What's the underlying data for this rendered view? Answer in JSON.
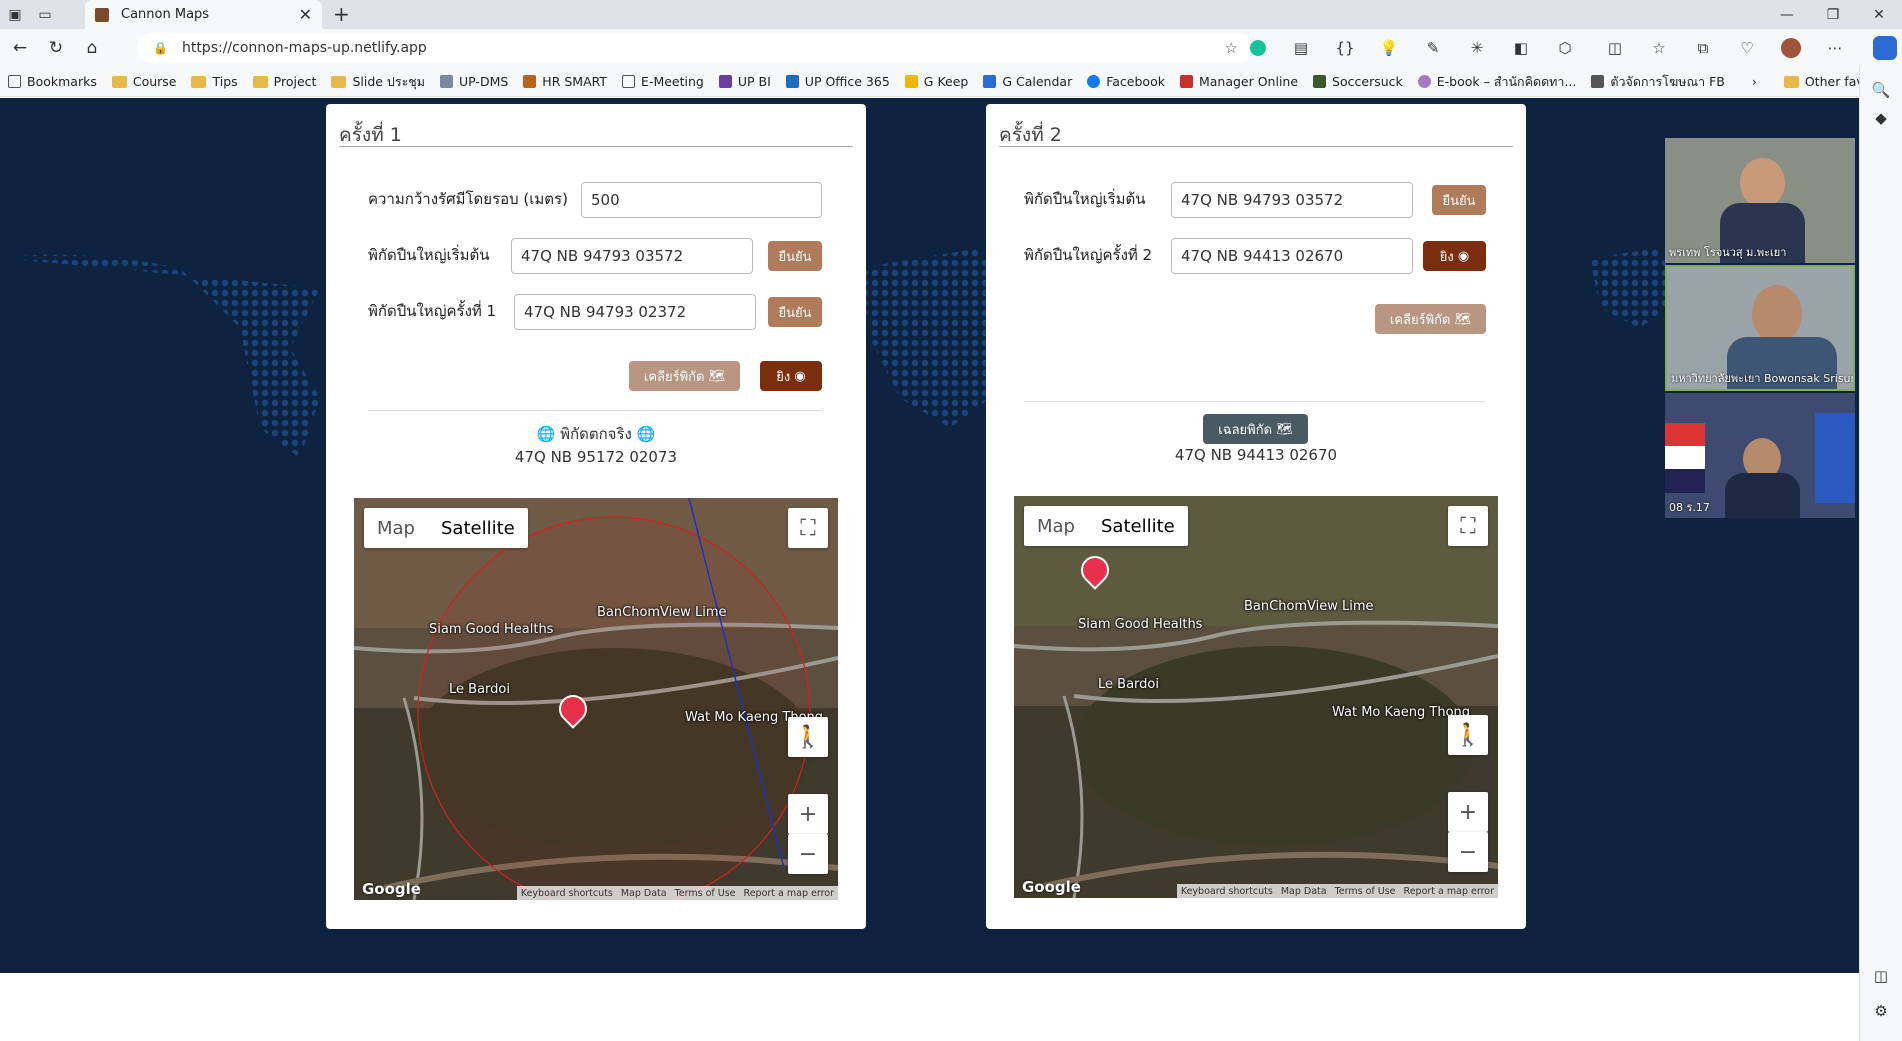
{
  "browser": {
    "tab_title": "Cannon Maps",
    "url": "https://connon-maps-up.netlify.app",
    "bookmarks": [
      "Bookmarks",
      "Course",
      "Tips",
      "Project",
      "Slide ประชุม",
      "UP-DMS",
      "HR SMART",
      "E-Meeting",
      "UP BI",
      "UP Office 365",
      "G Keep",
      "G Calendar",
      "Facebook",
      "Manager Online",
      "Soccersuck",
      "E-book – สำนักคิดดทา...",
      "ตัวจัดการโฆษณา FB"
    ],
    "other_favorites": "Other favorites"
  },
  "card1": {
    "title": "ครั้งที่ 1",
    "radius_label": "ความกว้างรัศมีโดยรอบ (เมตร)",
    "radius_value": "500",
    "start_label": "พิกัดปืนใหญ่เริ่มต้น",
    "start_value": "47Q NB 94793 03572",
    "shot1_label": "พิกัดปืนใหญ่ครั้งที่ 1",
    "shot1_value": "47Q NB 94793 02372",
    "confirm": "ยืนยัน",
    "clear": "เคลียร์พิกัด",
    "fire": "ยิง",
    "actual_label": "พิกัดตกจริง",
    "actual_value": "47Q NB 95172 02073"
  },
  "card2": {
    "title": "ครั้งที่ 2",
    "start_label": "พิกัดปืนใหญ่เริ่มต้น",
    "start_value": "47Q NB 94793 03572",
    "shot2_label": "พิกัดปืนใหญ่ครั้งที่ 2",
    "shot2_value": "47Q NB 94413 02670",
    "confirm": "ยืนยัน",
    "fire": "ยิง",
    "clear": "เคลียร์พิกัด",
    "solve": "เฉลยพิกัด",
    "result_value": "47Q NB 94413 02670"
  },
  "map": {
    "type_map": "Map",
    "type_satellite": "Satellite",
    "labels": [
      "Siam Good Healths",
      "BanChomView Lime",
      "Le Bardoi",
      "Wat Mo Kaeng Thong"
    ],
    "attribution": [
      "Keyboard shortcuts",
      "Map Data",
      "Terms of Use",
      "Report a map error"
    ],
    "google": "Google"
  },
  "video": {
    "p1": "พรเทพ โรจนวสุ ม.พะเยา",
    "p2": "มหาวิทยาลัยพะเยา Bowonsak Srisungs...",
    "p3": "08 ร.17"
  }
}
